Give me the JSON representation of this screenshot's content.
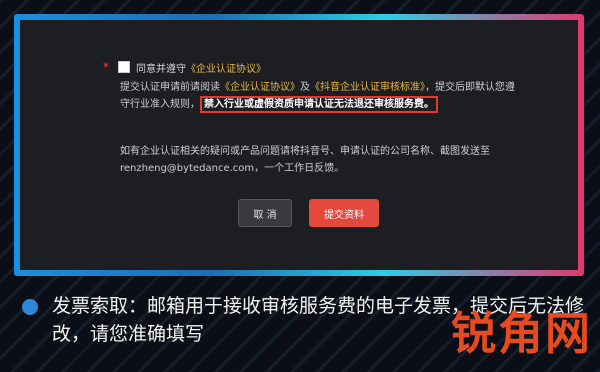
{
  "dialog": {
    "required_marker": "*",
    "agree_text": "同意并遵守",
    "agree_link": "《企业认证协议》",
    "para1_part1": "提交认证申请前请阅读",
    "para1_link1": "《企业认证协议》",
    "para1_part2": "及",
    "para1_link2": "《抖音企业认证审核标准》",
    "para1_part3": "，提交后即默认您遵守行业准入规则，",
    "para1_highlight": "禁入行业或虚假资质申请认证无法退还审核服务费。",
    "para2": "如有企业认证相关的疑问或产品问题请将抖音号、申请认证的公司名称、截图发送至renzheng@bytedance.com，一个工作日反馈。",
    "cancel_label": "取 消",
    "submit_label": "提交资料"
  },
  "caption": {
    "text": "发票索取：邮箱用于接收审核服务费的电子发票，提交后无法修改，请您准确填写"
  },
  "watermark": {
    "text": "锐角网"
  },
  "colors": {
    "accent_red": "#e2483c",
    "link_gold": "#e8b84a",
    "bullet_blue": "#2f86d8"
  }
}
